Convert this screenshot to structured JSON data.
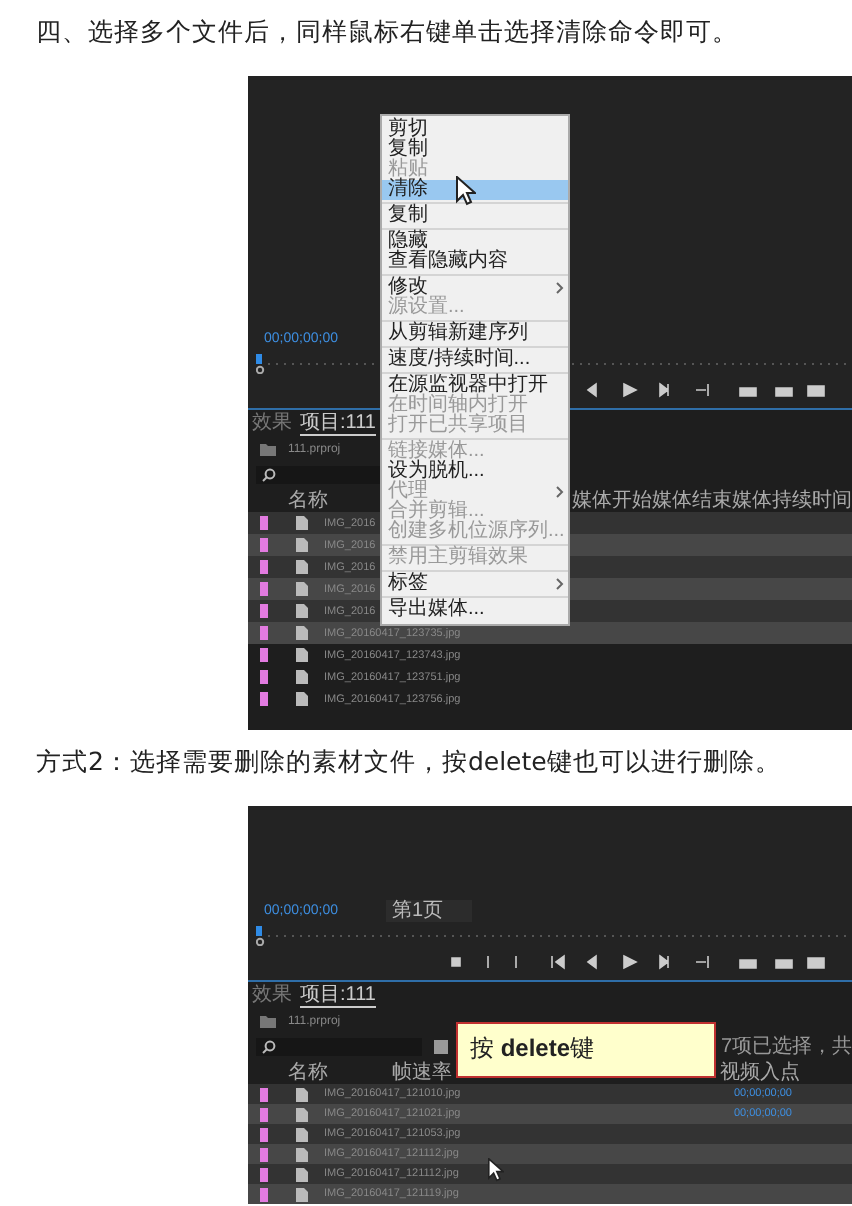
{
  "blocks": [
    {
      "kind": "text",
      "text": "四、选择多个文件后，同样鼠标右键单击选择清除命令即可。"
    },
    {
      "kind": "screenshot",
      "timecode": "00;00;00;00",
      "tabs": [
        {
          "label": "效果",
          "selected": false
        },
        {
          "label": "项目:111",
          "selected": true
        }
      ],
      "project_file": "111.prproj",
      "columns": [
        "名称",
        "媒体开始",
        "媒体结束",
        "媒体持续时间"
      ],
      "files": [
        {
          "name": "IMG_2016",
          "selected": true
        },
        {
          "name": "IMG_2016",
          "selected": true
        },
        {
          "name": "IMG_2016",
          "selected": true
        },
        {
          "name": "IMG_2016",
          "selected": true
        },
        {
          "name": "IMG_2016",
          "selected": true
        },
        {
          "name": "IMG_20160417_123735.jpg",
          "selected": true
        },
        {
          "name": "IMG_20160417_123743.jpg",
          "selected": false
        },
        {
          "name": "IMG_20160417_123751.jpg",
          "selected": false
        },
        {
          "name": "IMG_20160417_123756.jpg",
          "selected": false
        }
      ],
      "context_menu": {
        "groups": [
          [
            {
              "label": "剪切",
              "disabled": false,
              "selected": false,
              "submenu": false
            },
            {
              "label": "复制",
              "disabled": false,
              "selected": false,
              "submenu": false
            },
            {
              "label": "粘贴",
              "disabled": true,
              "selected": false,
              "submenu": false
            },
            {
              "label": "清除",
              "disabled": false,
              "selected": true,
              "submenu": false
            }
          ],
          [
            {
              "label": "复制",
              "disabled": false,
              "selected": false,
              "submenu": false
            }
          ],
          [
            {
              "label": "隐藏",
              "disabled": false,
              "selected": false,
              "submenu": false
            },
            {
              "label": "查看隐藏内容",
              "disabled": false,
              "selected": false,
              "submenu": false
            }
          ],
          [
            {
              "label": "修改",
              "disabled": false,
              "selected": false,
              "submenu": true
            },
            {
              "label": "源设置...",
              "disabled": true,
              "selected": false,
              "submenu": false
            }
          ],
          [
            {
              "label": "从剪辑新建序列",
              "disabled": false,
              "selected": false,
              "submenu": false
            }
          ],
          [
            {
              "label": "速度/持续时间...",
              "disabled": false,
              "selected": false,
              "submenu": false
            }
          ],
          [
            {
              "label": "在源监视器中打开",
              "disabled": false,
              "selected": false,
              "submenu": false
            },
            {
              "label": "在时间轴内打开",
              "disabled": true,
              "selected": false,
              "submenu": false
            },
            {
              "label": "打开已共享项目",
              "disabled": true,
              "selected": false,
              "submenu": false
            }
          ],
          [
            {
              "label": "链接媒体...",
              "disabled": true,
              "selected": false,
              "submenu": false
            },
            {
              "label": "设为脱机...",
              "disabled": false,
              "selected": false,
              "submenu": false
            },
            {
              "label": "代理",
              "disabled": true,
              "selected": false,
              "submenu": true
            },
            {
              "label": "合并剪辑...",
              "disabled": true,
              "selected": false,
              "submenu": false
            },
            {
              "label": "创建多机位源序列...",
              "disabled": true,
              "selected": false,
              "submenu": false
            }
          ],
          [
            {
              "label": "禁用主剪辑效果",
              "disabled": true,
              "selected": false,
              "submenu": false
            }
          ],
          [
            {
              "label": "标签",
              "disabled": false,
              "selected": false,
              "submenu": true
            }
          ],
          [
            {
              "label": "导出媒体...",
              "disabled": false,
              "selected": false,
              "submenu": false
            }
          ]
        ]
      }
    },
    {
      "kind": "text",
      "text": "方式2：选择需要删除的素材文件，按delete键也可以进行删除。"
    },
    {
      "kind": "screenshot",
      "timecode": "00;00;00;00",
      "page": "第1页",
      "tabs": [
        {
          "label": "效果",
          "selected": false
        },
        {
          "label": "项目:111",
          "selected": true
        }
      ],
      "project_file": "111.prproj",
      "selection_info": "7项已选择，共",
      "columns": [
        "名称",
        "帧速率",
        "视频入点"
      ],
      "files": [
        {
          "name": "IMG_20160417_121010.jpg",
          "selected": true,
          "in_point": "00;00;00;00"
        },
        {
          "name": "IMG_20160417_121021.jpg",
          "selected": true,
          "in_point": "00;00;00;00"
        },
        {
          "name": "IMG_20160417_121053.jpg",
          "selected": true
        },
        {
          "name": "IMG_20160417_121112.jpg",
          "selected": true
        },
        {
          "name": "IMG_20160417_121112.jpg",
          "selected": true
        },
        {
          "name": "IMG_20160417_121119.jpg",
          "selected": true
        }
      ],
      "tooltip": "按 **delete**键"
    }
  ]
}
